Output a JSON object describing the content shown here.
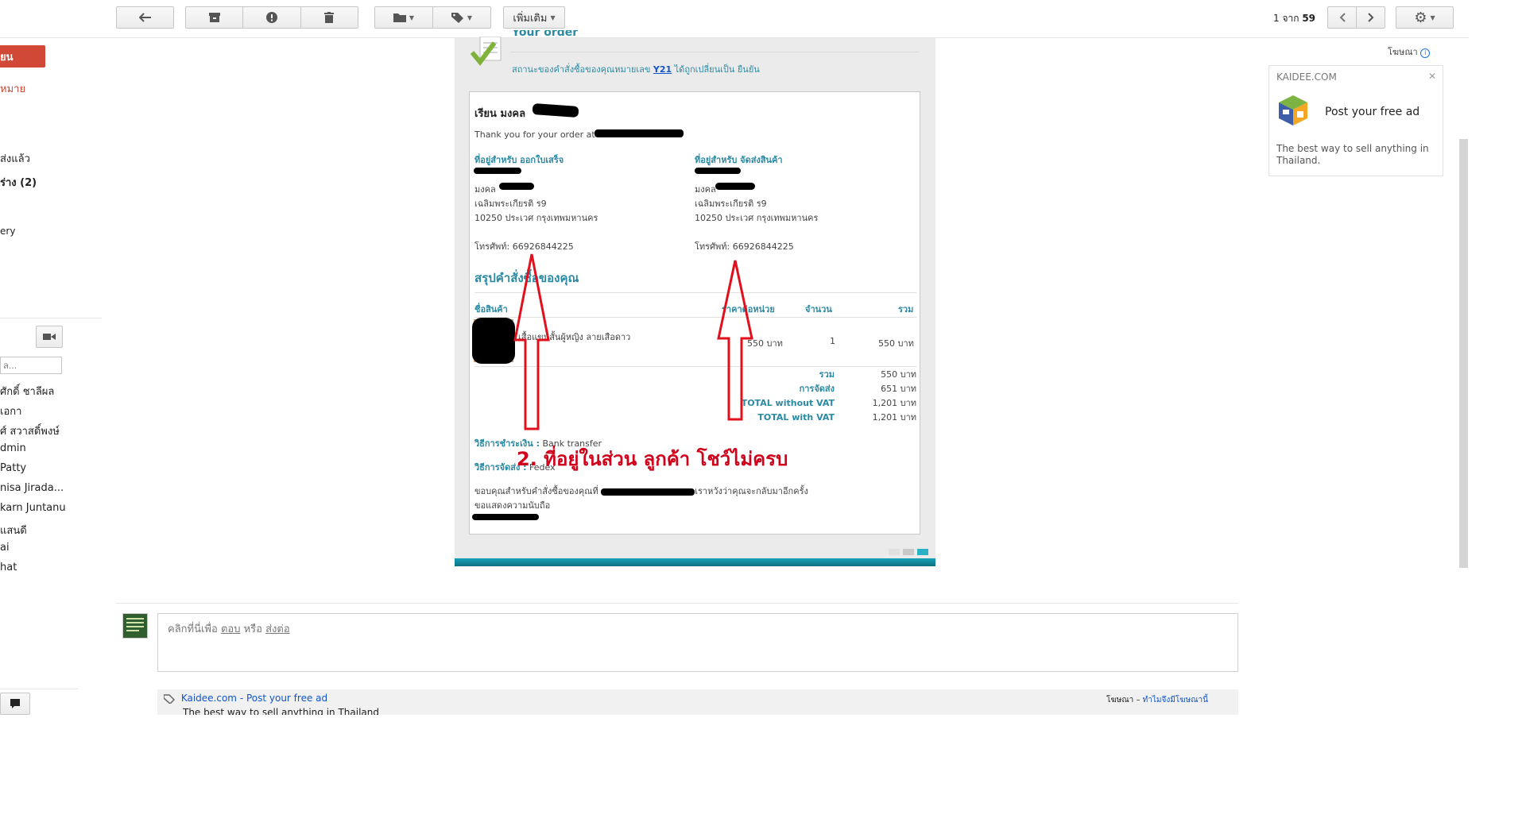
{
  "toolbar": {
    "more_label": "เพิ่มเติม",
    "page_count_prefix": "1 จาก ",
    "page_count_total": "59"
  },
  "left_nav": {
    "compose_label": "ยน",
    "items": [
      {
        "label": "หมาย"
      },
      {
        "label": "ส่งแล้ว"
      },
      {
        "label": "ร่าง (2)"
      },
      {
        "label": "ery"
      }
    ],
    "search_placeholder": "ล..."
  },
  "contacts": [
    "ศักดิ์ ชาลีผล",
    "เอกา",
    "ศ์ สวาสดิ์พงษ์",
    "dmin",
    "Patty",
    "nisa Jirada...",
    "karn Juntanu",
    "แสนดี",
    "ai",
    "hat"
  ],
  "email": {
    "header_title": "Your order",
    "status_prefix": "สถานะของคำสั่งซื้อของคุณหมายเลข ",
    "status_order_no": "Y21",
    "status_suffix": " ได้ถูกเปลี่ยนเป็น ยืนยัน",
    "greeting": "เรียน มงคล",
    "thanks": "Thank you for your order at",
    "billing": {
      "title": "ที่อยู่สำหรับ ออกใบเสร็จ",
      "line_name": "มงคล",
      "line1": "เฉลิมพระเกียรติ ร9",
      "line2": "10250 ประเวศ กรุงเทพมหานคร",
      "phone": "โทรศัพท์: 66926844225"
    },
    "shipping": {
      "title": "ที่อยู่สำหรับ จัดส่งสินค้า",
      "line_name": "มงคล",
      "line1": "เฉลิมพระเกียรติ ร9",
      "line2": "10250 ประเวศ กรุงเทพมหานคร",
      "phone": "โทรศัพท์: 66926844225"
    },
    "summary_title": "สรุปคำสั่งซื้อของคุณ",
    "table_headers": {
      "product": "ชื่อสินค้า",
      "unit_price": "ราคาต่อหน่วย",
      "qty": "จำนวน",
      "total": "รวม"
    },
    "item": {
      "name": "เสื้อแขนสั้นผู้หญิง ลายเสือดาว",
      "unit_price": "550 บาท",
      "qty": "1",
      "total": "550 บาท"
    },
    "totals": [
      {
        "label": "รวม",
        "value": "550 บาท"
      },
      {
        "label": "การจัดส่ง",
        "value": "651 บาท"
      },
      {
        "label": "TOTAL without VAT",
        "value": "1,201 บาท"
      },
      {
        "label": "TOTAL with VAT",
        "value": "1,201 บาท"
      }
    ],
    "payment_label": "วิธีการชำระเงิน :",
    "payment_value": "Bank transfer",
    "shipping_method_label": "วิธีการจัดส่ง :",
    "shipping_method_value": "Fedex",
    "thanks_footer_prefix": "ขอบคุณสำหรับคำสั่งซื้อของคุณที่ ",
    "thanks_footer_suffix": "เราหวังว่าคุณจะกลับมาอีกครั้ง",
    "regards": "ขอแสดงความนับถือ"
  },
  "annotation": {
    "text": "2. ที่อยู่ในส่วน   ลูกค้า   โชว์ไม่ครบ",
    "color": "#d0021b"
  },
  "reply": {
    "prompt_prefix": "คลิกที่นี่เพื่อ ",
    "reply_link": "ตอบ",
    "middle": " หรือ ",
    "forward_link": "ส่งต่อ"
  },
  "bottom_ad": {
    "source": "Kaidee.com",
    "title": " - Post your free ad",
    "desc": "The best way to sell anything in Thailand",
    "right_prefix": "โฆษณา – ",
    "right_link": "ทำไมจึงมีโฆษณานี้"
  },
  "side_ad": {
    "label": "โฆษณา",
    "site": "KAIDEE.COM",
    "title": "Post your free ad",
    "desc": "The best way to sell anything in Thailand."
  },
  "colors": {
    "accent": "#2b8aa3",
    "compose": "#d14836",
    "link": "#1155cc"
  }
}
